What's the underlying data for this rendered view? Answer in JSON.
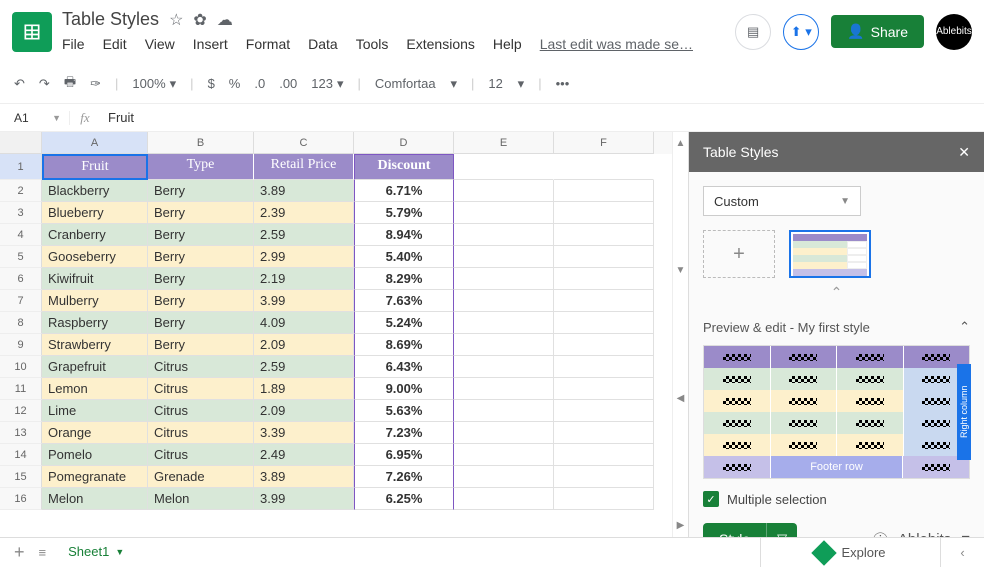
{
  "doc": {
    "title": "Table Styles",
    "last_edit": "Last edit was made se…"
  },
  "menus": [
    "File",
    "Edit",
    "View",
    "Insert",
    "Format",
    "Data",
    "Tools",
    "Extensions",
    "Help"
  ],
  "share": "Share",
  "avatar": "Ablebits",
  "toolbar": {
    "zoom": "100%",
    "currency": "$",
    "pct": "%",
    "dec1": ".0",
    "dec2": ".00",
    "fmt": "123",
    "font": "Comfortaa",
    "size": "12"
  },
  "formula": {
    "cell": "A1",
    "value": "Fruit"
  },
  "columns": [
    "A",
    "B",
    "C",
    "D",
    "E",
    "F"
  ],
  "headers": [
    "Fruit",
    "Type",
    "Retail Price",
    "Discount"
  ],
  "rows": [
    {
      "n": 2,
      "f": "Blackberry",
      "t": "Berry",
      "p": "3.89",
      "d": "6.71%"
    },
    {
      "n": 3,
      "f": "Blueberry",
      "t": "Berry",
      "p": "2.39",
      "d": "5.79%"
    },
    {
      "n": 4,
      "f": "Cranberry",
      "t": "Berry",
      "p": "2.59",
      "d": "8.94%"
    },
    {
      "n": 5,
      "f": "Gooseberry",
      "t": "Berry",
      "p": "2.99",
      "d": "5.40%"
    },
    {
      "n": 6,
      "f": "Kiwifruit",
      "t": "Berry",
      "p": "2.19",
      "d": "8.29%"
    },
    {
      "n": 7,
      "f": "Mulberry",
      "t": "Berry",
      "p": "3.99",
      "d": "7.63%"
    },
    {
      "n": 8,
      "f": "Raspberry",
      "t": "Berry",
      "p": "4.09",
      "d": "5.24%"
    },
    {
      "n": 9,
      "f": "Strawberry",
      "t": "Berry",
      "p": "2.09",
      "d": "8.69%"
    },
    {
      "n": 10,
      "f": "Grapefruit",
      "t": "Citrus",
      "p": "2.59",
      "d": "6.43%"
    },
    {
      "n": 11,
      "f": "Lemon",
      "t": "Citrus",
      "p": "1.89",
      "d": "9.00%"
    },
    {
      "n": 12,
      "f": "Lime",
      "t": "Citrus",
      "p": "2.09",
      "d": "5.63%"
    },
    {
      "n": 13,
      "f": "Orange",
      "t": "Citrus",
      "p": "3.39",
      "d": "7.23%"
    },
    {
      "n": 14,
      "f": "Pomelo",
      "t": "Citrus",
      "p": "2.49",
      "d": "6.95%"
    },
    {
      "n": 15,
      "f": "Pomegranate",
      "t": "Grenade",
      "p": "3.89",
      "d": "7.26%"
    },
    {
      "n": 16,
      "f": "Melon",
      "t": "Melon",
      "p": "3.99",
      "d": "6.25%"
    }
  ],
  "panel": {
    "title": "Table Styles",
    "dropdown": "Custom",
    "section": "Preview & edit - My first style",
    "right_col": "Right column",
    "footer_row": "Footer row",
    "multi": "Multiple selection",
    "style_btn": "Style",
    "brand": "Ablebits"
  },
  "sheet": {
    "name": "Sheet1",
    "explore": "Explore"
  }
}
